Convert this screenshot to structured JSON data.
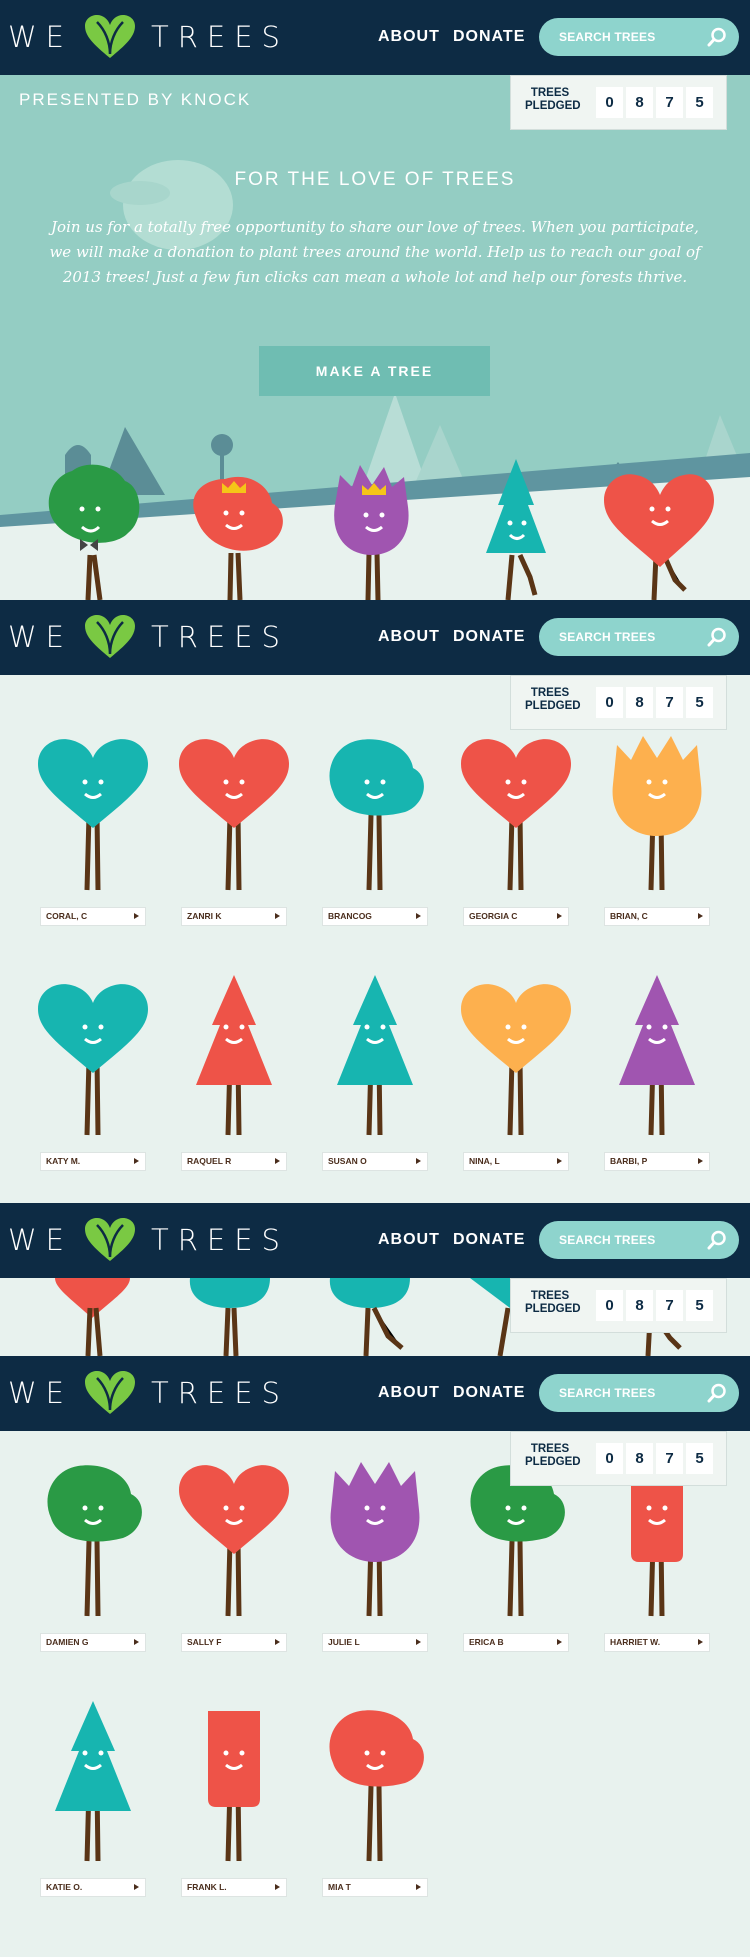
{
  "logo": {
    "left_word": "WE",
    "right_word": "TREES"
  },
  "nav": {
    "about": "ABOUT",
    "donate": "DONATE",
    "search_placeholder": "SEARCH TREES"
  },
  "counter": {
    "label_line1": "TREES",
    "label_line2": "PLEDGED",
    "digits": [
      "0",
      "8",
      "7",
      "5"
    ]
  },
  "hero": {
    "presented_by": "PRESENTED BY KNOCK",
    "title": "FOR THE LOVE OF TREES",
    "body": "Join us for a totally free opportunity to share our love of trees. When you participate, we will make a donation to plant trees around the world. Help us to reach our goal of 2013 trees! Just a few fun clicks can mean a whole lot and help our forests thrive.",
    "button": "MAKE A TREE"
  },
  "colors": {
    "navy": "#0d2b44",
    "mint": "#94cdc3",
    "search": "#8ed4cd",
    "bg": "#e8f2ee",
    "green": "#2a9a45",
    "red": "#ee5348",
    "purple": "#a055b0",
    "teal": "#17b5b0",
    "orange": "#fdb04e",
    "trunk": "#5a3516"
  },
  "grid1": [
    {
      "name": "CORAL, C",
      "shape": "heart",
      "color": "teal"
    },
    {
      "name": "ZANRI K",
      "shape": "heart",
      "color": "red"
    },
    {
      "name": "BRANCOG",
      "shape": "blob",
      "color": "teal"
    },
    {
      "name": "GEORGIA C",
      "shape": "heart",
      "color": "red"
    },
    {
      "name": "BRIAN, C",
      "shape": "flame",
      "color": "orange"
    },
    {
      "name": "KATY M.",
      "shape": "heart",
      "color": "teal"
    },
    {
      "name": "RAQUEL R",
      "shape": "pine",
      "color": "red"
    },
    {
      "name": "SUSAN O",
      "shape": "pine",
      "color": "teal"
    },
    {
      "name": "NINA, L",
      "shape": "heart",
      "color": "orange"
    },
    {
      "name": "BARBI, P",
      "shape": "pine",
      "color": "purple"
    }
  ],
  "grid2": [
    {
      "name": "DAMIEN G",
      "shape": "blob",
      "color": "green"
    },
    {
      "name": "SALLY F",
      "shape": "heart",
      "color": "red"
    },
    {
      "name": "JULIE L",
      "shape": "flame",
      "color": "purple"
    },
    {
      "name": "ERICA B",
      "shape": "blob",
      "color": "green"
    },
    {
      "name": "HARRIET W.",
      "shape": "rect",
      "color": "red"
    },
    {
      "name": "KATIE O.",
      "shape": "pine",
      "color": "teal"
    },
    {
      "name": "FRANK L.",
      "shape": "rect",
      "color": "red"
    },
    {
      "name": "MIA T",
      "shape": "blob",
      "color": "red"
    }
  ]
}
